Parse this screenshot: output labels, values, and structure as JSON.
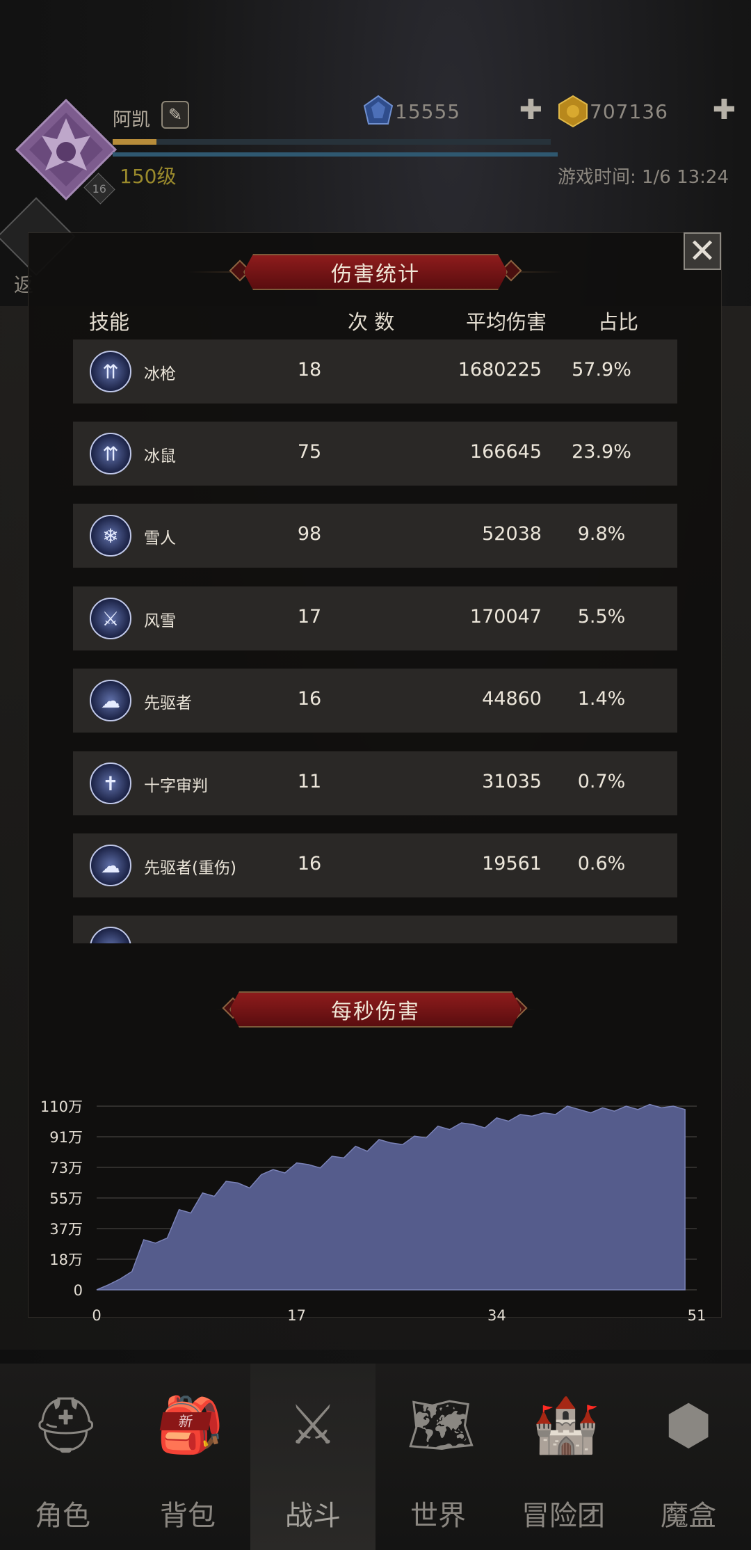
{
  "hud": {
    "player_name": "阿凯",
    "level": "150级",
    "level_badge": "16",
    "xp_fraction": 0.1,
    "crystal": "15555",
    "gold": "707136",
    "game_time": "游戏时间: 1/6 13:24",
    "back_label": "返"
  },
  "modal": {
    "close_symbol": "✕",
    "stats_title": "伤害统计",
    "dps_title": "每秒伤害",
    "columns": {
      "skill": "技能",
      "count": "次 数",
      "avg": "平均伤害",
      "share": "占比"
    },
    "rows": [
      {
        "name": "冰枪",
        "count": "18",
        "avg": "1680225",
        "share": "57.9%",
        "icon": "ice-spear-icon"
      },
      {
        "name": "冰鼠",
        "count": "75",
        "avg": "166645",
        "share": "23.9%",
        "icon": "ice-spear-icon"
      },
      {
        "name": "雪人",
        "count": "98",
        "avg": "52038",
        "share": "9.8%",
        "icon": "snowflake-icon"
      },
      {
        "name": "风雪",
        "count": "17",
        "avg": "170047",
        "share": "5.5%",
        "icon": "sword-icon"
      },
      {
        "name": "先驱者",
        "count": "16",
        "avg": "44860",
        "share": "1.4%",
        "icon": "mushroom-cloud-icon"
      },
      {
        "name": "十字审判",
        "count": "11",
        "avg": "31035",
        "share": "0.7%",
        "icon": "cross-banner-icon"
      },
      {
        "name": "先驱者(重伤)",
        "count": "16",
        "avg": "19561",
        "share": "0.6%",
        "icon": "mushroom-cloud-icon"
      }
    ]
  },
  "chart_data": {
    "type": "area",
    "title": "每秒伤害",
    "x_ticks": [
      "0",
      "17",
      "34",
      "51"
    ],
    "y_ticks": [
      "0",
      "18万",
      "37万",
      "55万",
      "73万",
      "91万",
      "110万"
    ],
    "xlim": [
      0,
      51
    ],
    "ylim": [
      0,
      1100000
    ],
    "fill_color": "#555c8c",
    "x": [
      0,
      1,
      2,
      3,
      4,
      5,
      6,
      7,
      8,
      9,
      10,
      11,
      12,
      13,
      14,
      15,
      16,
      17,
      18,
      19,
      20,
      21,
      22,
      23,
      24,
      25,
      26,
      27,
      28,
      29,
      30,
      31,
      32,
      33,
      34,
      35,
      36,
      37,
      38,
      39,
      40,
      41,
      42,
      43,
      44,
      45,
      46,
      47,
      48,
      49,
      50
    ],
    "y": [
      0,
      30000,
      65000,
      110000,
      300000,
      280000,
      310000,
      480000,
      460000,
      580000,
      560000,
      650000,
      640000,
      610000,
      690000,
      720000,
      700000,
      760000,
      750000,
      730000,
      800000,
      790000,
      860000,
      830000,
      900000,
      880000,
      870000,
      920000,
      910000,
      980000,
      960000,
      1000000,
      990000,
      970000,
      1030000,
      1010000,
      1050000,
      1040000,
      1060000,
      1050000,
      1100000,
      1080000,
      1060000,
      1090000,
      1070000,
      1100000,
      1080000,
      1110000,
      1090000,
      1100000,
      1080000
    ]
  },
  "nav": [
    {
      "label": "角色",
      "icon": "helmet-icon"
    },
    {
      "label": "背包",
      "icon": "backpack-icon",
      "badge": "新"
    },
    {
      "label": "战斗",
      "icon": "sword-shield-icon"
    },
    {
      "label": "世界",
      "icon": "map-scroll-icon"
    },
    {
      "label": "冒险团",
      "icon": "castle-icon"
    },
    {
      "label": "魔盒",
      "icon": "magic-cube-icon"
    }
  ]
}
